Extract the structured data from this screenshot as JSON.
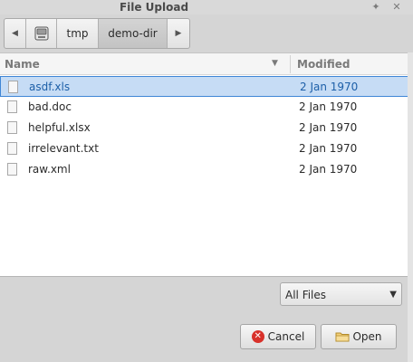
{
  "window": {
    "title": "File Upload",
    "pin_glyph": "✦",
    "close_glyph": "✕"
  },
  "pathbar": {
    "back_glyph": "◀",
    "forward_glyph": "▶",
    "drive_icon": "drive-icon",
    "segments": [
      "tmp",
      "demo-dir"
    ]
  },
  "columns": {
    "name": "Name",
    "modified": "Modified",
    "sort_glyph": "▼"
  },
  "files": [
    {
      "name": "asdf.xls",
      "modified": "2 Jan 1970",
      "selected": true
    },
    {
      "name": "bad.doc",
      "modified": "2 Jan 1970",
      "selected": false
    },
    {
      "name": "helpful.xlsx",
      "modified": "2 Jan 1970",
      "selected": false
    },
    {
      "name": "irrelevant.txt",
      "modified": "2 Jan 1970",
      "selected": false
    },
    {
      "name": "raw.xml",
      "modified": "2 Jan 1970",
      "selected": false
    }
  ],
  "filter": {
    "selected": "All Files",
    "caret_glyph": "▼"
  },
  "buttons": {
    "cancel": "Cancel",
    "cancel_glyph": "✕",
    "open": "Open"
  },
  "colors": {
    "selection_bg": "#c6dcf5",
    "selection_border": "#3f86d6",
    "cancel_icon": "#d8312a"
  }
}
